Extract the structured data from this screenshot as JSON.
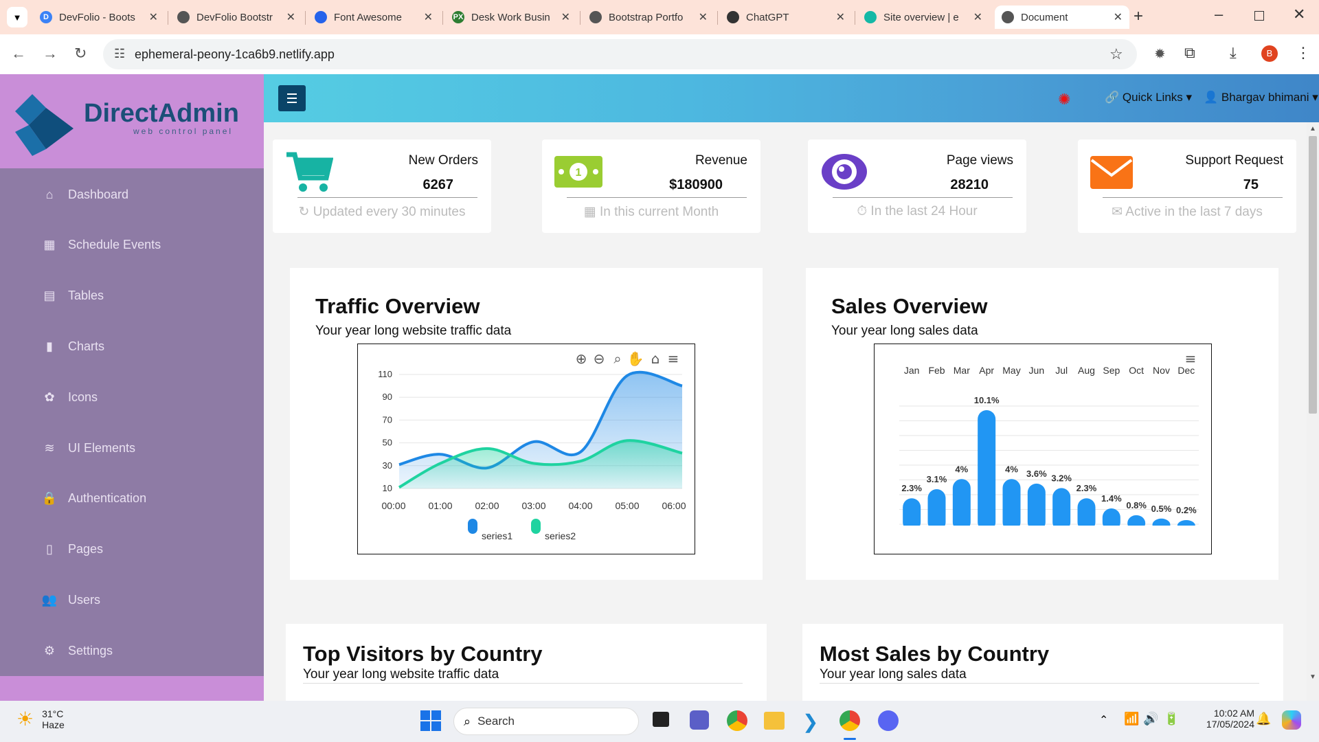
{
  "browser": {
    "tabs": [
      {
        "title": "DevFolio - Boots",
        "fav_color": "#3b82f6",
        "fav_letter": "D"
      },
      {
        "title": "DevFolio Bootstr",
        "fav_color": "#555555",
        "fav_letter": ""
      },
      {
        "title": "Font Awesome",
        "fav_color": "#2563eb",
        "fav_letter": ""
      },
      {
        "title": "Desk Work Busin",
        "fav_color": "#2e7d32",
        "fav_letter": "PX"
      },
      {
        "title": "Bootstrap Portfo",
        "fav_color": "#555555",
        "fav_letter": ""
      },
      {
        "title": "ChatGPT",
        "fav_color": "#333333",
        "fav_letter": ""
      },
      {
        "title": "Site overview | e",
        "fav_color": "#14b8a6",
        "fav_letter": ""
      },
      {
        "title": "Document",
        "fav_color": "#555555",
        "fav_letter": ""
      }
    ],
    "url": "ephemeral-peony-1ca6b9.netlify.app",
    "profile_letter": "B"
  },
  "sidebar": {
    "brand": "DirectAdmin",
    "brand_sub": "web control panel",
    "items": [
      {
        "label": "Dashboard",
        "icon": "home-icon",
        "glyph": "⌂"
      },
      {
        "label": "Schedule Events",
        "icon": "calendar-icon",
        "glyph": "▦"
      },
      {
        "label": "Tables",
        "icon": "table-icon",
        "glyph": "▤"
      },
      {
        "label": "Charts",
        "icon": "bar-chart-icon",
        "glyph": "▮"
      },
      {
        "label": "Icons",
        "icon": "icons-icon",
        "glyph": "✿"
      },
      {
        "label": "UI Elements",
        "icon": "layers-icon",
        "glyph": "≋"
      },
      {
        "label": "Authentication",
        "icon": "lock-icon",
        "glyph": "🔒"
      },
      {
        "label": "Pages",
        "icon": "file-icon",
        "glyph": "▯"
      },
      {
        "label": "Users",
        "icon": "users-icon",
        "glyph": "👥"
      },
      {
        "label": "Settings",
        "icon": "cogs-icon",
        "glyph": "⚙"
      }
    ]
  },
  "header": {
    "quick_links": "Quick Links",
    "user_name": "Bhargav bhimani"
  },
  "stats": [
    {
      "label": "New Orders",
      "value": "6267",
      "sub": "Updated every 30 minutes",
      "icon": "cart-icon",
      "color": "#17b3a3"
    },
    {
      "label": "Revenue",
      "value": "$180900",
      "sub": "In this current Month",
      "icon": "money-icon",
      "color": "#9acd32"
    },
    {
      "label": "Page views",
      "value": "28210",
      "sub": "In the last 24 Hour",
      "icon": "eye-icon",
      "color": "#6a3fc7"
    },
    {
      "label": "Support Request",
      "value": "75",
      "sub": "Active in the last 7 days",
      "icon": "envelope-icon",
      "color": "#f97316"
    }
  ],
  "traffic": {
    "title": "Traffic Overview",
    "subtitle": "Your year long website traffic data"
  },
  "sales": {
    "title": "Sales Overview",
    "subtitle": "Your year long sales data"
  },
  "visitors": {
    "title": "Top Visitors by Country",
    "subtitle": "Your year long website traffic data"
  },
  "most_sales": {
    "title": "Most Sales by Country",
    "subtitle": "Your year long sales data"
  },
  "chart_data": [
    {
      "type": "area",
      "categories": [
        "00:00",
        "01:00",
        "02:00",
        "03:00",
        "04:00",
        "05:00",
        "06:00"
      ],
      "ylim": [
        10,
        110
      ],
      "yticks": [
        10,
        30,
        50,
        70,
        90,
        110
      ],
      "series": [
        {
          "name": "series1",
          "color": "#1e88e5",
          "values": [
            31,
            40,
            28,
            51,
            42,
            109,
            100
          ]
        },
        {
          "name": "series2",
          "color": "#1fd3a0",
          "values": [
            11,
            32,
            45,
            32,
            34,
            52,
            41
          ]
        }
      ]
    },
    {
      "type": "bar",
      "categories": [
        "Jan",
        "Feb",
        "Mar",
        "Apr",
        "May",
        "Jun",
        "Jul",
        "Aug",
        "Sep",
        "Oct",
        "Nov",
        "Dec"
      ],
      "values": [
        2.3,
        3.1,
        4.0,
        10.1,
        4.0,
        3.6,
        3.2,
        2.3,
        1.4,
        0.8,
        0.5,
        0.2
      ],
      "labels": [
        "2.3%",
        "3.1%",
        "4%",
        "10.1%",
        "4%",
        "3.6%",
        "3.2%",
        "2.3%",
        "1.4%",
        "0.8%",
        "0.5%",
        "0.2%"
      ],
      "color": "#2196f3"
    }
  ],
  "taskbar": {
    "temp": "31°C",
    "weather": "Haze",
    "search": "Search",
    "time": "10:02 AM",
    "date": "17/05/2024"
  }
}
